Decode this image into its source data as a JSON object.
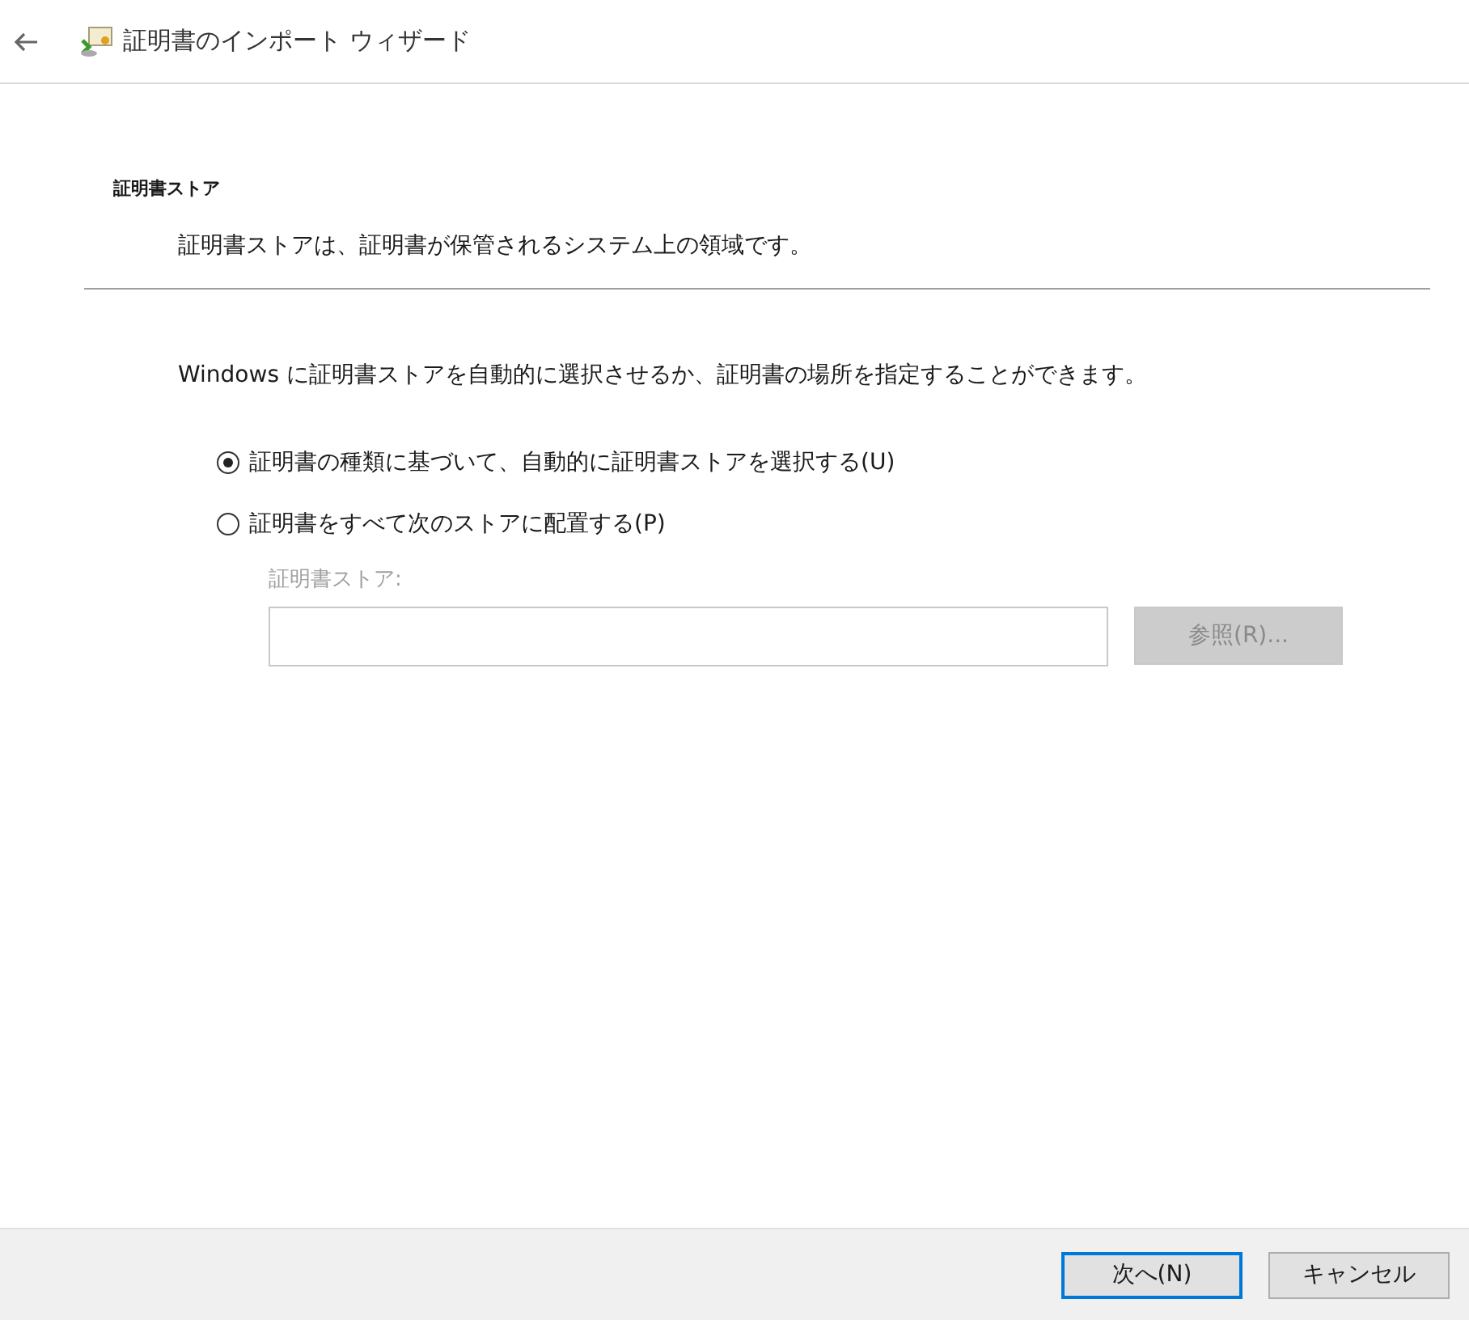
{
  "window": {
    "title": "証明書のインポート ウィザード"
  },
  "header": {
    "title": "証明書ストア",
    "description": "証明書ストアは、証明書が保管されるシステム上の領域です。"
  },
  "intro": "Windows に証明書ストアを自動的に選択させるか、証明書の場所を指定することができます。",
  "options": [
    {
      "label": "証明書の種類に基づいて、自動的に証明書ストアを選択する(U)",
      "selected": true
    },
    {
      "label": "証明書をすべて次のストアに配置する(P)",
      "selected": false
    }
  ],
  "store": {
    "label": "証明書ストア:",
    "disabled": true,
    "browse": "参照(R)..."
  },
  "buttons": [
    {
      "label": "次へ(N)",
      "default": true
    },
    {
      "label": "キャンセル",
      "default": false
    }
  ]
}
